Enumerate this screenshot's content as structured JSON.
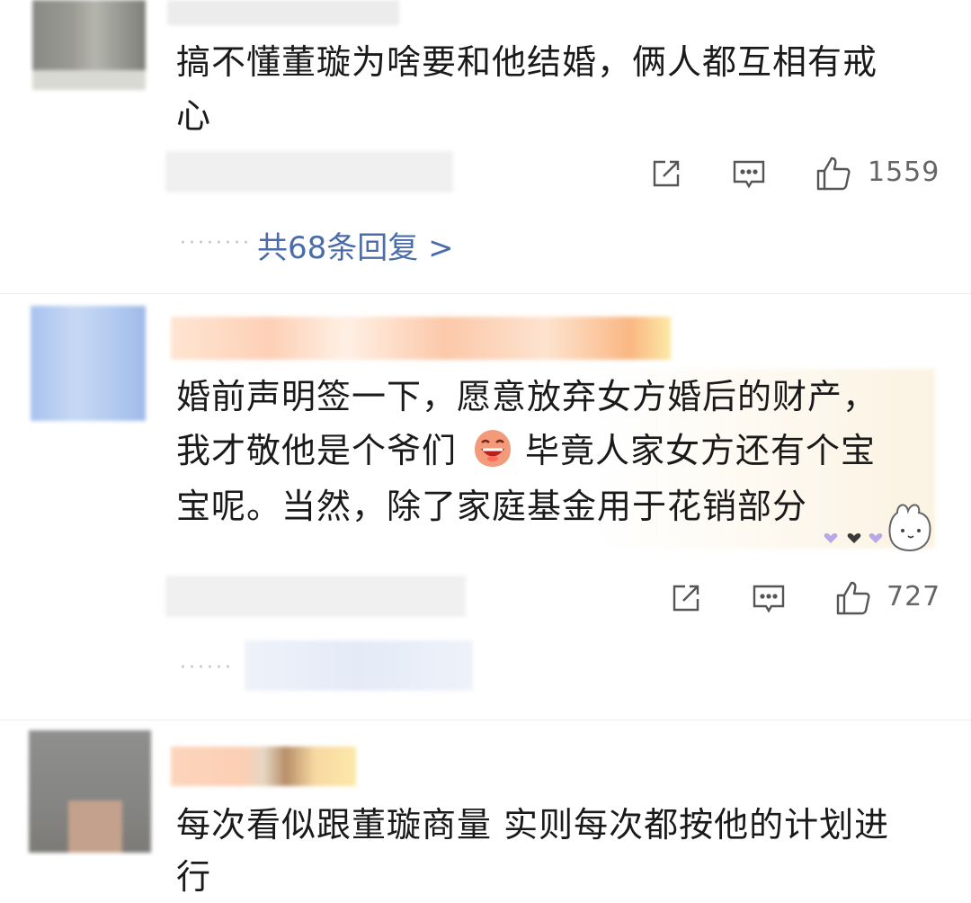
{
  "comments": [
    {
      "text_line1": "搞不懂董璇为啥要和他结婚，俩人都互相有戒",
      "text_line2": "心",
      "likes": "1559",
      "replies_label": "共68条回复 >"
    },
    {
      "text_line1": "婚前声明签一下，愿意放弃女方婚后的财产，",
      "text_line2a": "我才敬他是个爷们",
      "text_line2b": "毕竟人家女方还有个宝",
      "text_line3": "宝呢。当然，除了家庭基金用于花销部分",
      "likes": "727"
    },
    {
      "text_line1": "每次看似跟董璇商量 实则每次都按他的计划进",
      "text_line2": "行"
    }
  ],
  "icons": [
    "share-icon",
    "comment-icon",
    "like-icon",
    "laughing-emoji-icon",
    "bunny-sticker-icon"
  ],
  "colors": {
    "reply_link": "#4a6ca8",
    "count": "#666666"
  }
}
